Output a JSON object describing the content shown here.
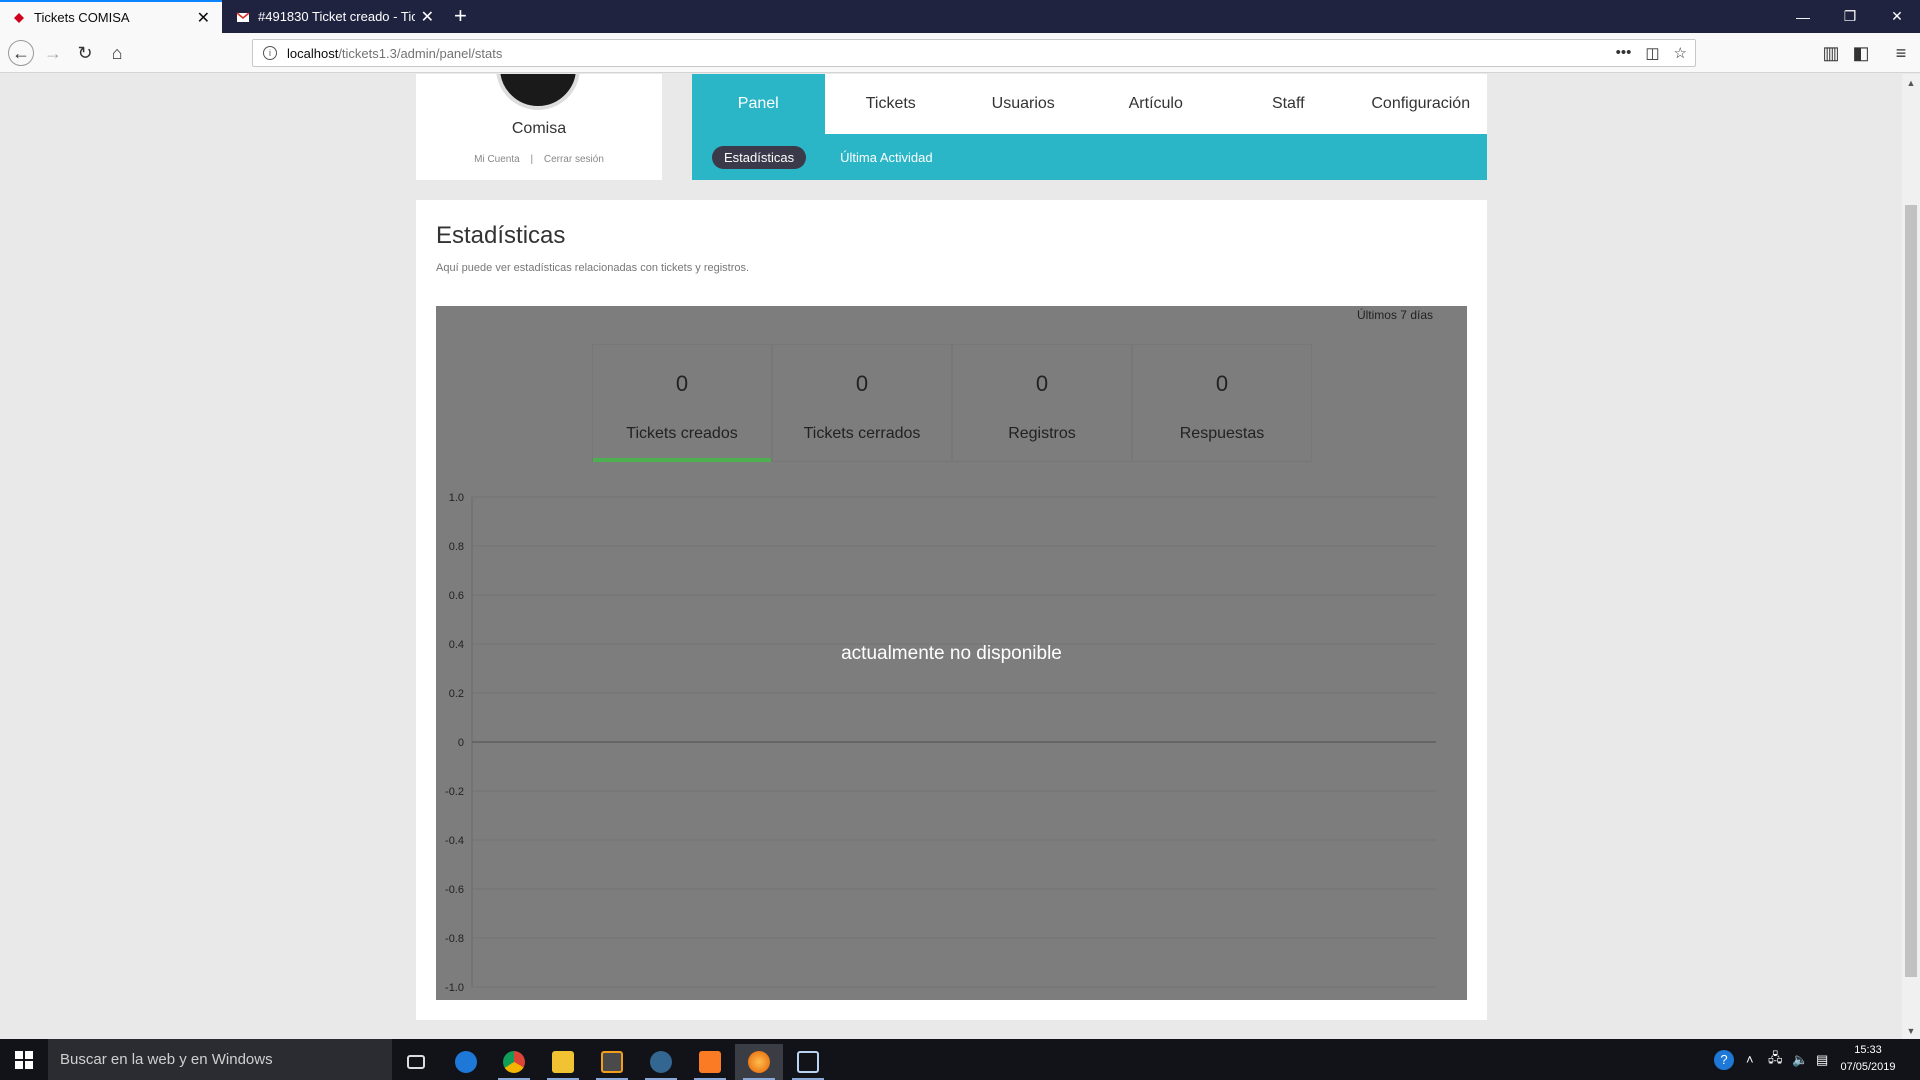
{
  "browser": {
    "tabs": [
      {
        "title": "Tickets COMISA",
        "active": true
      },
      {
        "title": "#491830 Ticket creado - Tickets",
        "active": false
      }
    ],
    "url_host": "localhost",
    "url_path": "/tickets1.3/admin/panel/stats"
  },
  "profile": {
    "name": "Comisa",
    "account_link": "Mi Cuenta",
    "separator": "|",
    "logout_link": "Cerrar sesión"
  },
  "menu": {
    "items": [
      "Panel",
      "Tickets",
      "Usuarios",
      "Artículo",
      "Staff",
      "Configuración"
    ],
    "active": "Panel"
  },
  "submenu": {
    "items": [
      "Estadísticas",
      "Última Actividad"
    ],
    "active": "Estadísticas"
  },
  "stats_page": {
    "title": "Estadísticas",
    "description": "Aquí puede ver estadísticas relacionadas con tickets y registros.",
    "period": "Últimos 7 días",
    "cards": [
      {
        "value": "0",
        "label": "Tickets creados"
      },
      {
        "value": "0",
        "label": "Tickets cerrados"
      },
      {
        "value": "0",
        "label": "Registros"
      },
      {
        "value": "0",
        "label": "Respuestas"
      }
    ],
    "unavailable_text": "actualmente no disponible"
  },
  "chart_data": {
    "type": "line",
    "title": "",
    "xlabel": "",
    "ylabel": "",
    "ylim": [
      -1.0,
      1.0
    ],
    "y_ticks": [
      "1.0",
      "0.8",
      "0.6",
      "0.4",
      "0.2",
      "0",
      "-0.2",
      "-0.4",
      "-0.6",
      "-0.8",
      "-1.0"
    ],
    "series": [],
    "grid": true
  },
  "taskbar": {
    "search_placeholder": "Buscar en la web y en Windows",
    "time": "15:33",
    "date": "07/05/2019"
  },
  "colors": {
    "accent": "#2bb6c8",
    "selected_bar": "#4caf50",
    "overlay": "#7d7d7d"
  }
}
